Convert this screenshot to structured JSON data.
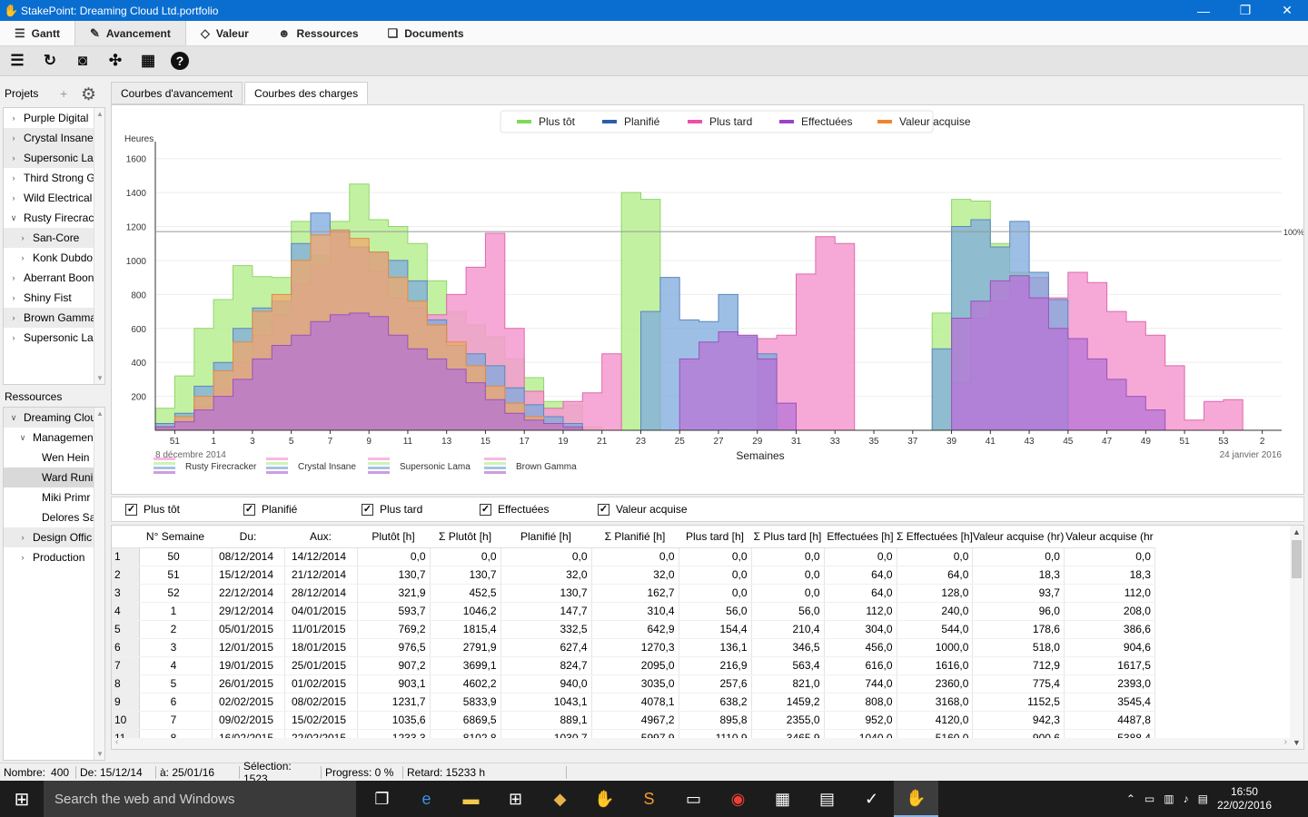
{
  "window": {
    "title": "StakePoint: Dreaming Cloud Ltd.portfolio"
  },
  "tabs": [
    {
      "label": "Gantt",
      "icon": "gantt-icon"
    },
    {
      "label": "Avancement",
      "icon": "progress-icon"
    },
    {
      "label": "Valeur",
      "icon": "tag-icon"
    },
    {
      "label": "Ressources",
      "icon": "people-icon"
    },
    {
      "label": "Documents",
      "icon": "documents-icon"
    }
  ],
  "active_tab": "Avancement",
  "projects_panel": {
    "label": "Projets",
    "items": [
      {
        "label": "Purple Digital",
        "twisty": ">",
        "indent": 0
      },
      {
        "label": "Crystal Insane",
        "twisty": ">",
        "indent": 0
      },
      {
        "label": "Supersonic Lar",
        "twisty": ">",
        "indent": 0
      },
      {
        "label": "Third Strong G",
        "twisty": ">",
        "indent": 0
      },
      {
        "label": "Wild Electrical",
        "twisty": ">",
        "indent": 0
      },
      {
        "label": "Rusty Firecrack",
        "twisty": "v",
        "indent": 0
      },
      {
        "label": "San-Core",
        "twisty": ">",
        "indent": 1
      },
      {
        "label": "Konk Dubdo",
        "twisty": ">",
        "indent": 1
      },
      {
        "label": "Aberrant Boon",
        "twisty": ">",
        "indent": 0
      },
      {
        "label": "Shiny Fist",
        "twisty": ">",
        "indent": 0
      },
      {
        "label": "Brown Gamma",
        "twisty": ">",
        "indent": 0
      },
      {
        "label": "Supersonic Lar",
        "twisty": ">",
        "indent": 0
      }
    ]
  },
  "resources_panel": {
    "label": "Ressources",
    "items": [
      {
        "label": "Dreaming Clou",
        "twisty": "v",
        "indent": 0
      },
      {
        "label": "Managemen",
        "twisty": "v",
        "indent": 1
      },
      {
        "label": "Wen Hein",
        "twisty": "",
        "indent": 2
      },
      {
        "label": "Ward Runi",
        "twisty": "",
        "indent": 2
      },
      {
        "label": "Miki Primr",
        "twisty": "",
        "indent": 2
      },
      {
        "label": "Delores Sa",
        "twisty": "",
        "indent": 2
      },
      {
        "label": "Design Offic",
        "twisty": ">",
        "indent": 1
      },
      {
        "label": "Production",
        "twisty": ">",
        "indent": 1
      }
    ]
  },
  "subtabs": [
    {
      "label": "Courbes d'avancement"
    },
    {
      "label": "Courbes des charges"
    }
  ],
  "checkboxes": [
    {
      "label": "Plus tôt",
      "checked": true
    },
    {
      "label": "Planifié",
      "checked": true
    },
    {
      "label": "Plus tard",
      "checked": true
    },
    {
      "label": "Effectuées",
      "checked": true
    },
    {
      "label": "Valeur acquise",
      "checked": true
    }
  ],
  "chart_data": {
    "type": "area",
    "ylabel": "Heures",
    "xlabel": "Semaines",
    "x_start_label": "8 décembre 2014",
    "x_end_label": "24 janvier 2016",
    "ylim": [
      0,
      1700
    ],
    "yticks": [
      200,
      400,
      600,
      800,
      1000,
      1200,
      1400,
      1600
    ],
    "x_tick_labels": [
      "51",
      "1",
      "3",
      "5",
      "7",
      "9",
      "11",
      "13",
      "15",
      "17",
      "19",
      "21",
      "23",
      "25",
      "27",
      "29",
      "31",
      "33",
      "35",
      "37",
      "39",
      "41",
      "43",
      "45",
      "47",
      "49",
      "51",
      "53",
      "2"
    ],
    "threshold": {
      "value": 1170,
      "label": "100%"
    },
    "legend_top": [
      {
        "name": "Plus tôt",
        "color": "#7fd95c"
      },
      {
        "name": "Planifié",
        "color": "#2c5ea8"
      },
      {
        "name": "Plus tard",
        "color": "#ee4fa9"
      },
      {
        "name": "Effectuées",
        "color": "#9b43c6"
      },
      {
        "name": "Valeur acquise",
        "color": "#f0852d"
      }
    ],
    "legend_bottom": [
      {
        "name": "Rusty Firecracker"
      },
      {
        "name": "Crystal Insane"
      },
      {
        "name": "Supersonic Lama"
      },
      {
        "name": "Brown Gamma"
      }
    ],
    "series": [
      {
        "name": "Plus tôt",
        "color": "#b6ec90",
        "values": [
          130,
          320,
          600,
          770,
          970,
          905,
          900,
          1230,
          1030,
          1230,
          1450,
          1240,
          1200,
          1100,
          880,
          700,
          620,
          550,
          420,
          310,
          170,
          150,
          20,
          0,
          0,
          0,
          0,
          0,
          0,
          0,
          0,
          0,
          0,
          0,
          0,
          0,
          0,
          0,
          0,
          0,
          0,
          1400,
          1360,
          1180,
          950,
          0,
          0,
          0,
          0,
          0,
          0,
          0,
          0,
          0,
          0,
          0,
          0,
          0,
          0,
          0,
          0,
          0,
          0,
          0,
          0,
          0,
          0,
          0,
          0,
          0,
          0,
          0,
          0,
          0,
          0,
          0,
          0,
          0,
          0,
          0,
          0,
          0,
          0,
          0,
          0,
          0,
          0,
          0,
          0,
          0,
          0,
          0,
          0,
          0,
          0,
          0,
          0,
          0,
          0,
          0,
          0,
          0,
          0,
          0,
          0,
          0,
          0,
          0,
          0,
          0,
          0,
          0,
          0,
          0,
          0,
          0,
          0,
          0,
          0,
          0,
          0,
          0,
          0,
          0,
          0,
          0,
          0,
          0,
          0,
          0,
          0,
          0,
          0,
          0,
          0,
          0,
          0,
          0,
          0,
          0,
          0,
          0,
          0,
          0,
          0,
          0,
          0,
          0,
          0,
          0,
          0,
          0,
          0,
          0,
          0,
          0,
          0,
          0,
          0,
          0,
          0,
          0,
          0,
          0,
          0,
          0,
          0,
          0,
          0,
          0,
          0,
          0,
          0,
          0,
          0,
          0,
          0,
          0,
          0,
          0,
          0,
          0,
          0,
          0,
          0,
          0,
          0,
          0,
          0,
          0,
          0,
          0,
          0,
          0,
          0,
          0,
          0,
          0,
          0,
          0,
          0,
          0,
          0,
          0,
          0,
          0,
          0,
          0,
          0,
          0,
          0,
          0,
          0,
          0,
          0,
          0,
          0,
          0,
          0,
          0,
          0,
          0,
          0,
          0,
          0,
          0,
          0,
          0,
          0,
          0,
          0,
          0,
          0,
          0,
          0,
          0,
          0,
          0,
          0,
          0,
          0,
          0,
          0,
          0,
          0,
          0,
          0,
          0,
          0,
          0,
          0,
          0,
          0,
          0,
          0,
          0,
          0,
          0,
          0,
          0,
          0,
          0,
          0,
          0,
          0,
          0,
          0,
          0,
          0,
          0,
          0,
          0,
          0,
          0,
          0,
          0,
          0,
          0,
          0,
          0,
          0,
          0,
          0,
          0,
          0,
          0,
          0
        ]
      },
      {
        "name": "Plus tôt (suite)",
        "color": "#b6ec90",
        "values": []
      }
    ]
  },
  "chart_render": {
    "weeks": [
      "51",
      "52",
      "1",
      "2",
      "3",
      "4",
      "5",
      "6",
      "7",
      "8",
      "9",
      "10",
      "11",
      "12",
      "13",
      "14",
      "15",
      "16",
      "17",
      "18",
      "19",
      "20",
      "21",
      "22",
      "23",
      "24",
      "25",
      "26",
      "27",
      "28",
      "29",
      "30",
      "31",
      "32",
      "33",
      "34",
      "35",
      "36",
      "37",
      "38",
      "39",
      "40",
      "41",
      "42",
      "43",
      "44",
      "45",
      "46",
      "47",
      "48",
      "49",
      "50",
      "51",
      "52",
      "53",
      "1",
      "2",
      "3"
    ],
    "plus_tot": [
      130,
      320,
      600,
      770,
      970,
      905,
      900,
      1230,
      1030,
      1230,
      1450,
      1240,
      1200,
      1100,
      880,
      700,
      620,
      550,
      420,
      310,
      170,
      150,
      20,
      0,
      1400,
      1360,
      0,
      0,
      0,
      0,
      0,
      0,
      0,
      0,
      0,
      0,
      0,
      0,
      0,
      0,
      690,
      1360,
      1350,
      1100,
      930,
      0,
      0,
      0,
      0,
      0,
      0,
      0,
      0,
      0,
      0,
      0,
      0,
      0
    ],
    "planifie": [
      40,
      100,
      260,
      400,
      600,
      720,
      760,
      1100,
      1280,
      1170,
      1080,
      1050,
      1000,
      880,
      650,
      500,
      450,
      380,
      250,
      150,
      80,
      40,
      0,
      0,
      0,
      700,
      900,
      650,
      640,
      800,
      550,
      450,
      0,
      0,
      0,
      0,
      0,
      0,
      0,
      0,
      480,
      1200,
      1240,
      1080,
      1230,
      930,
      770,
      0,
      0,
      0,
      0,
      0,
      0,
      0,
      0,
      0,
      0,
      0
    ],
    "plus_tard": [
      20,
      60,
      140,
      240,
      400,
      560,
      680,
      860,
      970,
      1160,
      1080,
      940,
      780,
      720,
      680,
      800,
      960,
      1160,
      600,
      230,
      130,
      170,
      220,
      450,
      0,
      0,
      0,
      0,
      0,
      0,
      0,
      540,
      560,
      920,
      1140,
      1100,
      0,
      0,
      0,
      0,
      0,
      280,
      660,
      760,
      880,
      900,
      780,
      930,
      870,
      700,
      640,
      560,
      380,
      60,
      170,
      180,
      0,
      0
    ],
    "effectuees": [
      20,
      50,
      120,
      200,
      300,
      420,
      500,
      560,
      640,
      680,
      690,
      670,
      560,
      480,
      420,
      360,
      280,
      180,
      100,
      60,
      40,
      20,
      0,
      0,
      0,
      0,
      0,
      420,
      520,
      580,
      560,
      420,
      160,
      0,
      0,
      0,
      0,
      0,
      0,
      0,
      0,
      660,
      760,
      880,
      910,
      780,
      600,
      540,
      420,
      300,
      200,
      120,
      0,
      0,
      0,
      0,
      0,
      0
    ],
    "valeur": [
      20,
      80,
      200,
      350,
      520,
      700,
      800,
      1000,
      1150,
      1180,
      1130,
      1050,
      900,
      760,
      620,
      520,
      380,
      260,
      160,
      80,
      40,
      10,
      0,
      0,
      0,
      0,
      0,
      0,
      0,
      0,
      0,
      0,
      0,
      0,
      0,
      0,
      0,
      0,
      0,
      0,
      0,
      0,
      0,
      0,
      0,
      0,
      0,
      0,
      0,
      0,
      0,
      0,
      0,
      0,
      0,
      0,
      0,
      0
    ]
  },
  "table": {
    "columns": [
      "N° Semaine",
      "Du:",
      "Aux:",
      "Plutôt [h]",
      "Σ Plutôt [h]",
      "Planifié [h]",
      "Σ Planifié [h]",
      "Plus tard [h]",
      "Σ Plus tard [h]",
      "Effectuées [h]",
      "Σ Effectuées [h]",
      "Valeur acquise (hr)",
      "Valeur acquise (hr"
    ],
    "rows": [
      [
        "1",
        "50",
        "08/12/2014",
        "14/12/2014",
        "0,0",
        "0,0",
        "0,0",
        "0,0",
        "0,0",
        "0,0",
        "0,0",
        "0,0",
        "0,0",
        "0,0"
      ],
      [
        "2",
        "51",
        "15/12/2014",
        "21/12/2014",
        "130,7",
        "130,7",
        "32,0",
        "32,0",
        "0,0",
        "0,0",
        "64,0",
        "64,0",
        "18,3",
        "18,3"
      ],
      [
        "3",
        "52",
        "22/12/2014",
        "28/12/2014",
        "321,9",
        "452,5",
        "130,7",
        "162,7",
        "0,0",
        "0,0",
        "64,0",
        "128,0",
        "93,7",
        "112,0"
      ],
      [
        "4",
        "1",
        "29/12/2014",
        "04/01/2015",
        "593,7",
        "1046,2",
        "147,7",
        "310,4",
        "56,0",
        "56,0",
        "112,0",
        "240,0",
        "96,0",
        "208,0"
      ],
      [
        "5",
        "2",
        "05/01/2015",
        "11/01/2015",
        "769,2",
        "1815,4",
        "332,5",
        "642,9",
        "154,4",
        "210,4",
        "304,0",
        "544,0",
        "178,6",
        "386,6"
      ],
      [
        "6",
        "3",
        "12/01/2015",
        "18/01/2015",
        "976,5",
        "2791,9",
        "627,4",
        "1270,3",
        "136,1",
        "346,5",
        "456,0",
        "1000,0",
        "518,0",
        "904,6"
      ],
      [
        "7",
        "4",
        "19/01/2015",
        "25/01/2015",
        "907,2",
        "3699,1",
        "824,7",
        "2095,0",
        "216,9",
        "563,4",
        "616,0",
        "1616,0",
        "712,9",
        "1617,5"
      ],
      [
        "8",
        "5",
        "26/01/2015",
        "01/02/2015",
        "903,1",
        "4602,2",
        "940,0",
        "3035,0",
        "257,6",
        "821,0",
        "744,0",
        "2360,0",
        "775,4",
        "2393,0"
      ],
      [
        "9",
        "6",
        "02/02/2015",
        "08/02/2015",
        "1231,7",
        "5833,9",
        "1043,1",
        "4078,1",
        "638,2",
        "1459,2",
        "808,0",
        "3168,0",
        "1152,5",
        "3545,4"
      ],
      [
        "10",
        "7",
        "09/02/2015",
        "15/02/2015",
        "1035,6",
        "6869,5",
        "889,1",
        "4967,2",
        "895,8",
        "2355,0",
        "952,0",
        "4120,0",
        "942,3",
        "4487,8"
      ],
      [
        "11",
        "8",
        "16/02/2015",
        "22/02/2015",
        "1233,3",
        "8102,8",
        "1030,7",
        "5997,9",
        "1110,9",
        "3465,9",
        "1040,0",
        "5160,0",
        "900,6",
        "5388,4"
      ]
    ]
  },
  "status": {
    "nombre_label": "Nombre:",
    "nombre": "400",
    "de": "De: 15/12/14",
    "a": "à: 25/01/16",
    "selection": "Sélection: 1523",
    "progress": "Progress: 0 %",
    "retard": "Retard: 15233 h"
  },
  "taskbar": {
    "search_placeholder": "Search the web and Windows",
    "time": "16:50",
    "date": "22/02/2016"
  }
}
